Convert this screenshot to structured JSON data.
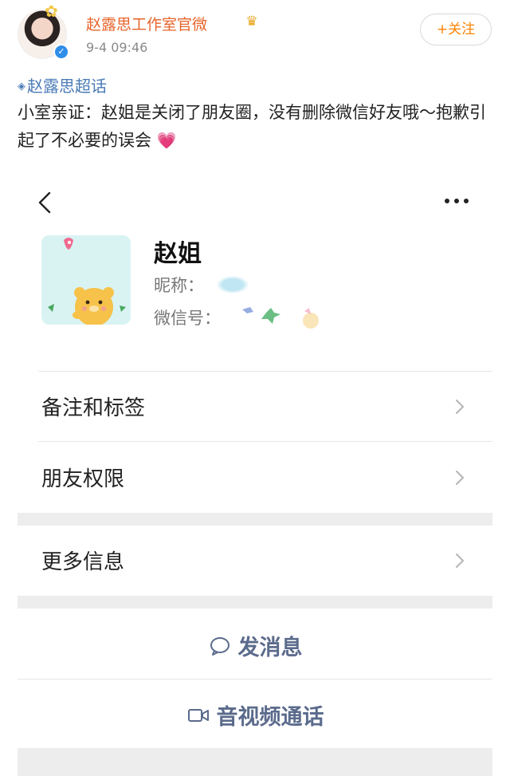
{
  "post": {
    "author": "赵露思工作室官微",
    "time": "9-4 09:46",
    "follow_label": "+关注",
    "topic": "赵露思超话",
    "text": "小室亲证：赵姐是关闭了朋友圈，没有删除微信好友哦～抱歉引起了不必要的误会",
    "emoji": "💗"
  },
  "icons": {
    "verified": "verified-badge-icon",
    "crown": "member-crown-icon",
    "topic": "super-topic-icon",
    "back": "back-arrow-icon",
    "more": "more-dots-icon",
    "chevron": "chevron-right-icon",
    "message": "chat-bubble-icon",
    "video": "video-camera-icon"
  },
  "wechat": {
    "contact_name": "赵姐",
    "nickname_label": "昵称：",
    "wechat_id_label": "微信号：",
    "rows": [
      {
        "label": "备注和标签"
      },
      {
        "label": "朋友权限"
      },
      {
        "label": "更多信息"
      }
    ],
    "actions": {
      "message_label": "发消息",
      "video_call_label": "音视频通话"
    }
  },
  "colors": {
    "author": "#e8632a",
    "topic": "#4a7bb7",
    "follow": "#ff8200",
    "action": "#5b6b8c",
    "separator": "#ededed"
  }
}
